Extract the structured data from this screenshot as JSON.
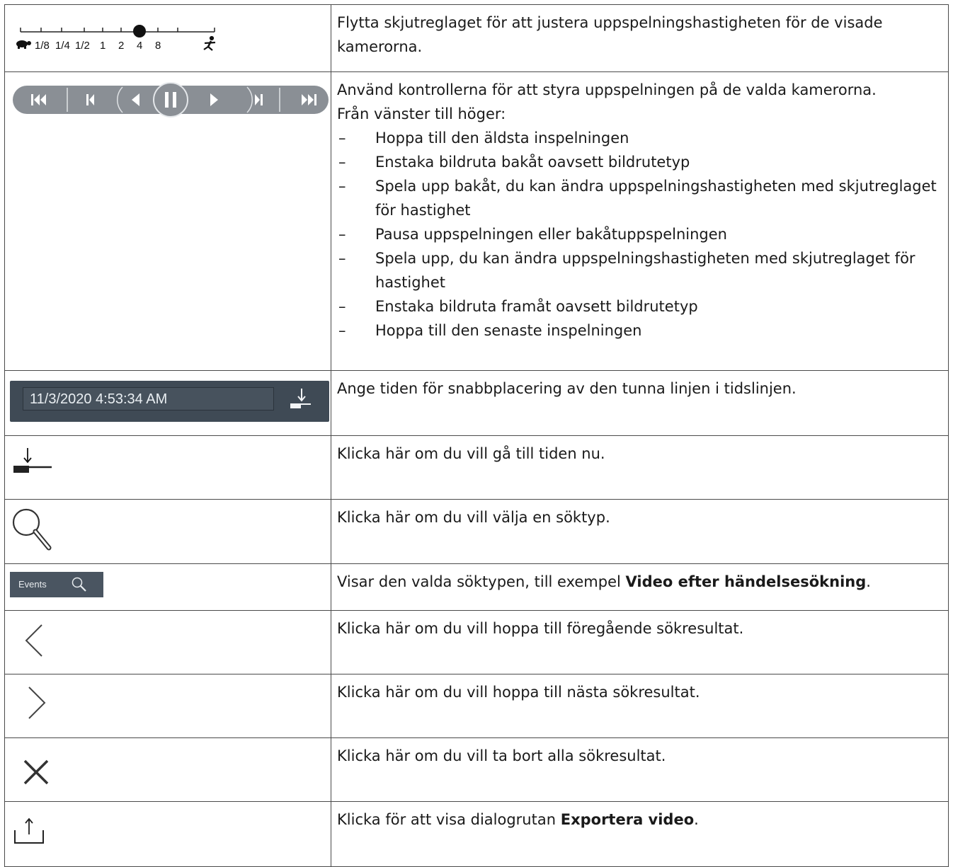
{
  "speed_slider": {
    "labels": [
      "1/8",
      "1/4",
      "1/2",
      "1",
      "2",
      "4",
      "8"
    ],
    "selected": "2",
    "description": "Flytta skjutreglaget för att justera uppspelningshastigheten för de visade kamerorna."
  },
  "playback_controls": {
    "intro_line1": "Använd kontrollerna för att styra uppspelningen på de valda kamerorna.",
    "intro_line2": "Från vänster till höger:",
    "items": [
      "Hoppa till den äldsta inspelningen",
      "Enstaka bildruta bakåt oavsett bildrutetyp",
      "Spela upp bakåt, du kan ändra uppspelningshastigheten med skjutreglaget för hastighet",
      "Pausa uppspelningen eller bakåtuppspelningen",
      "Spela upp, du kan ändra uppspelningshastigheten med skjutreglaget för hastighet",
      "Enstaka bildruta framåt oavsett bildrutetyp",
      "Hoppa till den senaste inspelningen"
    ]
  },
  "date_jump": {
    "value": "11/3/2020 4:53:34 AM",
    "description": "Ange tiden för snabbplacering av den tunna linjen i tidslinjen."
  },
  "jump_now": {
    "description": "Klicka här om du vill gå till tiden nu."
  },
  "search": {
    "description": "Klicka här om du vill välja en söktyp."
  },
  "events_search": {
    "button_label": "Events",
    "description_prefix": "Visar den valda söktypen, till exempel ",
    "description_bold": "Video efter händelsesökning",
    "description_suffix": "."
  },
  "prev_result": {
    "description": "Klicka här om du vill hoppa till föregående sökresultat."
  },
  "next_result": {
    "description": "Klicka här om du vill hoppa till nästa sökresultat."
  },
  "clear_results": {
    "description": "Klicka här om du vill ta bort alla sökresultat."
  },
  "export_video": {
    "description_prefix": "Klicka för att visa dialogrutan ",
    "description_bold": "Exportera video",
    "description_suffix": "."
  },
  "colors": {
    "border": "#4a4a4a",
    "control_dark": "#3f4a55",
    "pill": "#8a8f95"
  }
}
